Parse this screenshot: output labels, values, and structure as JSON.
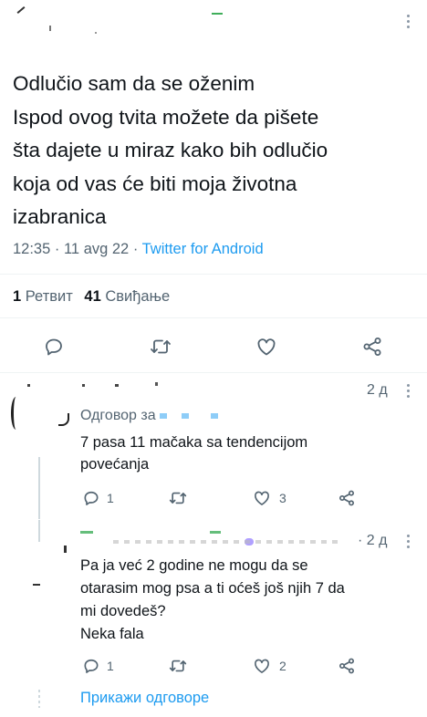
{
  "tweet": {
    "text_lines": [
      "Odlučio sam da se oženim",
      "Ispod ovog tvita možete da pišete",
      "šta dajete u miraz kako bih odlučio",
      "koja od vas će biti moja životna",
      "izabranica"
    ],
    "time": "12:35",
    "date": "11 avg 22",
    "dot": "·",
    "source": "Twitter for Android",
    "stats": {
      "retweets_count": "1",
      "retweets_label": "Ретвит",
      "likes_count": "41",
      "likes_label": "Свиђање"
    },
    "actions": [
      "reply-icon",
      "retweet-icon",
      "like-icon",
      "share-icon"
    ]
  },
  "replies": [
    {
      "age": "2 д",
      "replying_to_label": "Одговор за",
      "text": "7 pasa 11 mačaka sa tendencijom povećanja",
      "reply_count": "1",
      "like_count": "3"
    },
    {
      "age": "· 2 д",
      "text_lines": [
        "Pa ja već 2 godine ne mogu da se",
        "otarasim mog psa a ti oćeš još njih 7 da",
        "mi dovedeš?",
        "Neka fala"
      ],
      "reply_count": "1",
      "like_count": "2"
    }
  ],
  "show_replies_label": "Прикажи одговоре",
  "colors": {
    "accent": "#1d9bf0",
    "muted": "#536471",
    "divider": "#eff3f4"
  }
}
